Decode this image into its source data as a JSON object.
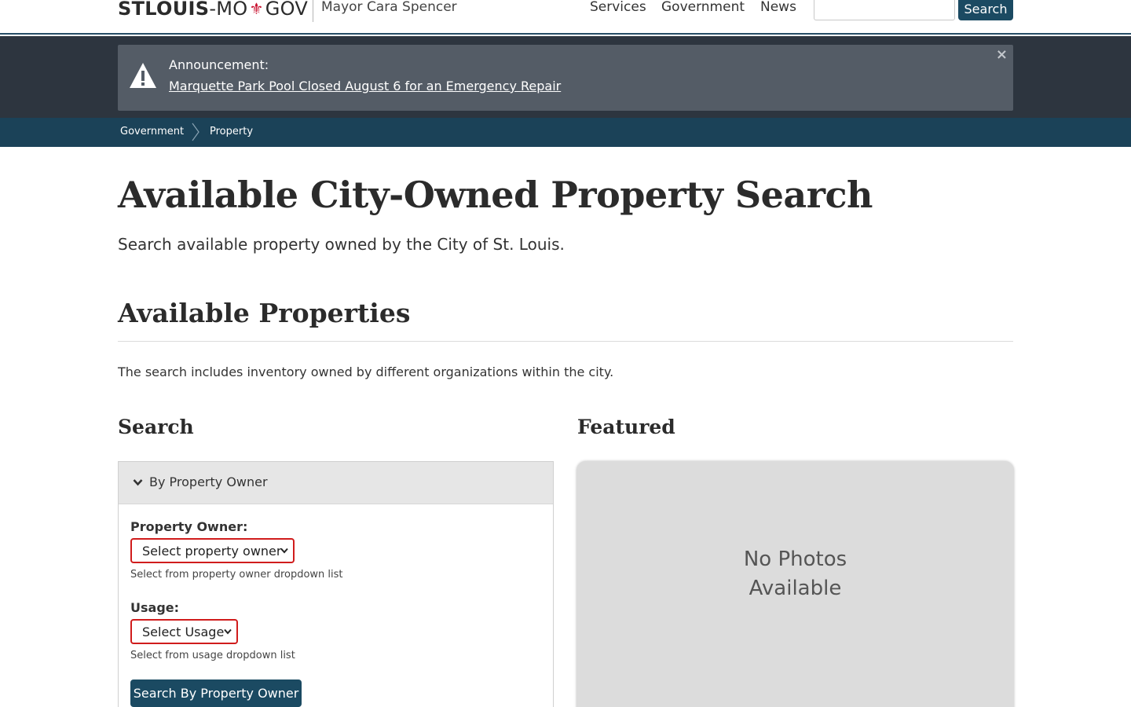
{
  "header": {
    "logo": {
      "part1": "STLOUIS",
      "part2": "-MO",
      "part3": "GOV"
    },
    "mayor": "Mayor Cara Spencer",
    "nav": [
      "Services",
      "Government",
      "News"
    ],
    "search_button": "Search"
  },
  "announcement": {
    "label": "Announcement:",
    "link": "Marquette Park Pool Closed August 6 for an Emergency Repair",
    "close": "×"
  },
  "breadcrumb": [
    "Government",
    "Property"
  ],
  "main": {
    "title": "Available City-Owned Property Search",
    "lead": "Search available property owned by the City of St. Louis.",
    "section_title": "Available Properties",
    "note": "The search includes inventory owned by different organizations within the city.",
    "search_heading": "Search",
    "featured_heading": "Featured"
  },
  "search_panel": {
    "header": "By Property Owner",
    "owner_label": "Property Owner:",
    "owner_select": "Select property owner",
    "owner_help": "Select from property owner dropdown list",
    "usage_label": "Usage:",
    "usage_select": "Select Usage",
    "usage_help": "Select from usage dropdown list",
    "submit": "Search By Property Owner"
  },
  "featured": {
    "line1": "No Photos",
    "line2": "Available"
  },
  "colors": {
    "brand_blue": "#1b4a62",
    "announcement_bg": "#545c66",
    "breadcrumb_bg": "#1b4258",
    "required_border": "#d01c1c",
    "fleur_red": "#c8102e"
  }
}
